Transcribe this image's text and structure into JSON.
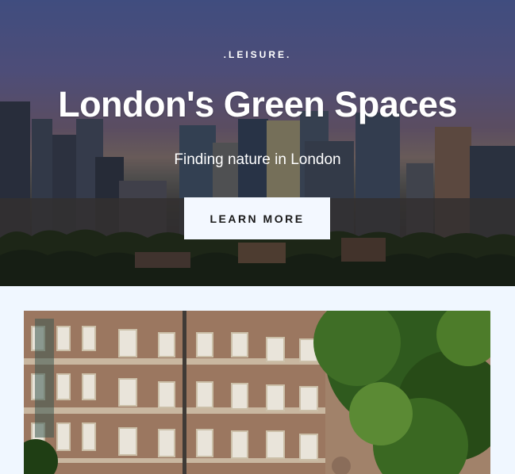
{
  "hero": {
    "kicker": ".LEISURE.",
    "title": "London's Green Spaces",
    "subtitle": "Finding nature in London",
    "cta_label": "LEARN MORE"
  },
  "images": {
    "hero_background": "london-skyline-photo",
    "feature_photo": "brick-building-and-tree-photo"
  }
}
